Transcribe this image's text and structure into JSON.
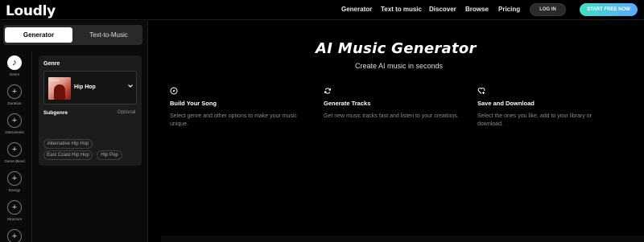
{
  "app": {
    "name": "Loudly"
  },
  "nav": {
    "items": [
      "Generator",
      "Text to music",
      "Discover",
      "Browse",
      "Pricing"
    ],
    "login_label": "LOG IN",
    "start_label": "START FREE NOW"
  },
  "mode_tabs": {
    "active": "Generator",
    "inactive": "Text-to-Music"
  },
  "rail": {
    "items": [
      {
        "label": "Genre",
        "icon": "music-note-icon",
        "active": true
      },
      {
        "label": "Duration",
        "icon": "plus-icon",
        "active": false
      },
      {
        "label": "Instruments",
        "icon": "plus-icon",
        "active": false
      },
      {
        "label": "Genre Blend",
        "icon": "plus-icon",
        "active": false
      },
      {
        "label": "Energy",
        "icon": "plus-icon",
        "active": false
      },
      {
        "label": "Structure",
        "icon": "plus-icon",
        "active": false
      },
      {
        "label": "",
        "icon": "plus-icon",
        "active": false
      }
    ]
  },
  "genre_card": {
    "title": "Genre",
    "selected": "Hip Hop",
    "thumb_text": "Hip Hop",
    "subgenre_title": "Subgenre",
    "optional_label": "Optional",
    "chips": [
      "Alternative Hip Hop",
      "East Coast Hip Hop",
      "Hip Pop"
    ]
  },
  "main": {
    "title": "AI Music Generator",
    "subtitle": "Create AI music in seconds",
    "features": [
      {
        "icon": "compass-icon",
        "title": "Build Your Song",
        "desc": "Select genre and other options to make your music unique."
      },
      {
        "icon": "refresh-icon",
        "title": "Generate Tracks",
        "desc": "Get new music tracks fast and listen to your creations."
      },
      {
        "icon": "heart-plus-icon",
        "title": "Save and Download",
        "desc": "Select the ones you like, add to your library or download."
      }
    ]
  },
  "colors": {
    "accent_start": "#3fe0c5",
    "accent_end": "#5aa8ff",
    "background": "#000000",
    "panel": "#1c1c1c"
  }
}
